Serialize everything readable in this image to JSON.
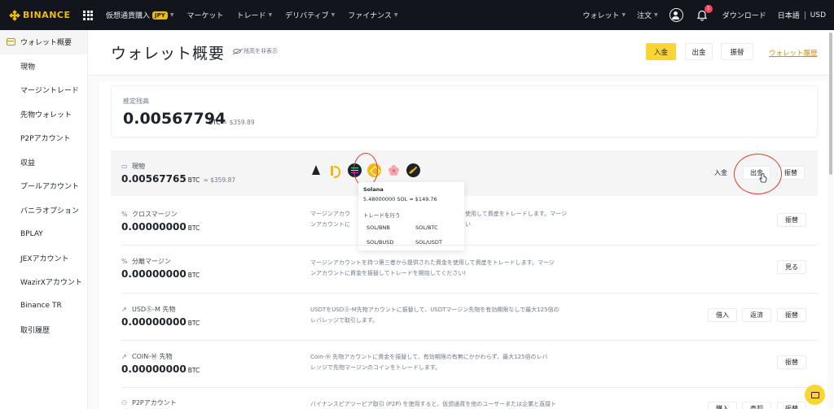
{
  "topnav": {
    "logo": "BINANCE",
    "items": [
      {
        "label": "仮想通貨購入",
        "badge": "JPY",
        "caret": true
      },
      {
        "label": "マーケット",
        "caret": false
      },
      {
        "label": "トレード",
        "caret": true
      },
      {
        "label": "デリバティブ",
        "caret": true
      },
      {
        "label": "ファイナンス",
        "caret": true
      }
    ],
    "right": {
      "wallet": "ウォレット",
      "orders": "注文",
      "notif_count": "1",
      "download": "ダウンロード",
      "language": "日本語",
      "currency": "USD"
    }
  },
  "sidebar": {
    "items": [
      "ウォレット概要",
      "現物",
      "マージントレード",
      "先物ウォレット",
      "P2Pアカウント",
      "収益",
      "プールアカウント",
      "バニラオプション",
      "BPLAY",
      "JEXアカウント",
      "WazirXアカウント",
      "Binance TR",
      "取引履歴"
    ]
  },
  "header": {
    "title": "ウォレット概要",
    "hide_balance": "残高を非表示",
    "deposit": "入金",
    "withdraw": "出金",
    "transfer": "振替",
    "history": "ウォレット履歴"
  },
  "estimated": {
    "label": "推定残高",
    "value": "0.00567794",
    "unit": "BTC",
    "approx": "≈ $359.89"
  },
  "spot": {
    "title": "現物",
    "amount": "0.00567765",
    "unit": "BTC",
    "approx": "≈ $359.87",
    "deposit": "入金",
    "withdraw": "出金",
    "transfer": "振替"
  },
  "popup": {
    "coin": "Solana",
    "balance": "5.48000000 SOL ≈ $149.76",
    "trade_label": "トレードを行う",
    "pairs": [
      "SOL/BNB",
      "SOL/BTC",
      "SOL/BUSD",
      "SOL/USDT"
    ]
  },
  "rows": [
    {
      "title": "クロスマージン",
      "amount": "0.00000000",
      "unit": "BTC",
      "desc_lines": [
        "マージンアカウ",
        "ンアカウントに"
      ],
      "desc_right_lines": [
        "使用して資産をトレードします。マージ",
        "い"
      ],
      "buttons": [
        "振替"
      ]
    },
    {
      "title": "分離マージン",
      "amount": "0.00000000",
      "unit": "BTC",
      "desc_lines": [
        "マージンアカウントを持つ第三者から提供された資金を使用して資産をトレードします。マージ",
        "ンアカウントに資金を振替してトレードを開始してください!"
      ],
      "buttons": [
        "見る"
      ]
    },
    {
      "title": "USDⓈ-M 先物",
      "amount": "0.00000000",
      "unit": "BTC",
      "desc_lines": [
        "USDTをUSDⓈ-M先物アカウントに振替して、USDTマージン先物を有効期限なしで最大125倍の",
        "レバレッジで取引します。"
      ],
      "buttons": [
        "借入",
        "返済",
        "振替"
      ]
    },
    {
      "title": "COIN-Ⓜ 先物",
      "amount": "0.00000000",
      "unit": "BTC",
      "desc_lines": [
        "Coin-Ⓜ 先物アカウントに資金を振替して、有効期限の有無にかかわらず、最大125倍のレバ",
        "レッジで先物マージンのコインをトレードします。"
      ],
      "buttons": [
        "振替"
      ]
    },
    {
      "title": "P2Pアカウント",
      "desc_lines": [
        "バイナンスピアツーピア取引 (P2P) を使用すると、仮想通貨を他のユーザーまたは企業と直接ト"
      ],
      "buttons": [
        "購入",
        "売却",
        "振替"
      ]
    }
  ],
  "colors": {
    "brand": "#f0b90b",
    "primary_button": "#fcd535",
    "link": "#c99400",
    "annotation": "#e03c31",
    "topbar": "#12161c"
  }
}
